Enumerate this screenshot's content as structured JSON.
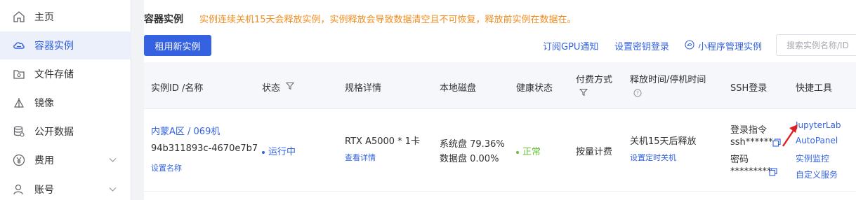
{
  "sidebar": {
    "items": [
      {
        "label": "主页",
        "icon": "home-icon"
      },
      {
        "label": "容器实例",
        "icon": "cloud-icon",
        "active": true
      },
      {
        "label": "文件存储",
        "icon": "folder-icon"
      },
      {
        "label": "镜像",
        "icon": "image-icon"
      },
      {
        "label": "公开数据",
        "icon": "database-icon"
      },
      {
        "label": "费用",
        "icon": "yen-icon",
        "expandable": true
      },
      {
        "label": "账号",
        "icon": "user-icon",
        "expandable": true
      }
    ]
  },
  "header": {
    "title": "容器实例",
    "notice": "实例连续关机15天会释放实例，实例释放会导致数据清空且不可恢复，释放前实例在数据在。"
  },
  "toolbar": {
    "rent_label": "租用新实例",
    "subscribe_gpu": "订阅GPU通知",
    "set_key_login": "设置密钥登录",
    "miniprogram_manage": "小程序管理实例",
    "search_placeholder": "搜索实例名称/ID"
  },
  "table": {
    "headers": {
      "instance": "实例ID /名称",
      "status": "状态",
      "spec": "规格详情",
      "disk": "本地磁盘",
      "health": "健康状态",
      "billing": "付费方式",
      "release": "释放时间/停机时间",
      "ssh": "SSH登录",
      "tools": "快捷工具"
    },
    "rows": [
      {
        "region": "内蒙A区 / 069机",
        "id": "94b311893c-4670e7b7",
        "set_name": "设置名称",
        "status": "运行中",
        "gpu": "RTX A5000 * 1卡",
        "view_detail": "查看详情",
        "system_disk": "系统盘 79.36%",
        "data_disk": "数据盘 0.00%",
        "health": "正常",
        "billing": "按量计费",
        "release": "关机15天后释放",
        "schedule_shutdown": "设置定时关机",
        "ssh_cmd_label": "登录指令",
        "ssh_cmd": "ssh******",
        "password_label": "密码",
        "password": "*********",
        "tools": [
          "JupyterLab",
          "AutoPanel",
          "实例监控",
          "自定义服务"
        ]
      }
    ]
  },
  "colors": {
    "accent": "#3462e0",
    "warning": "#f08c1e",
    "success": "#67c23a",
    "annotation_arrow": "#e02020"
  }
}
